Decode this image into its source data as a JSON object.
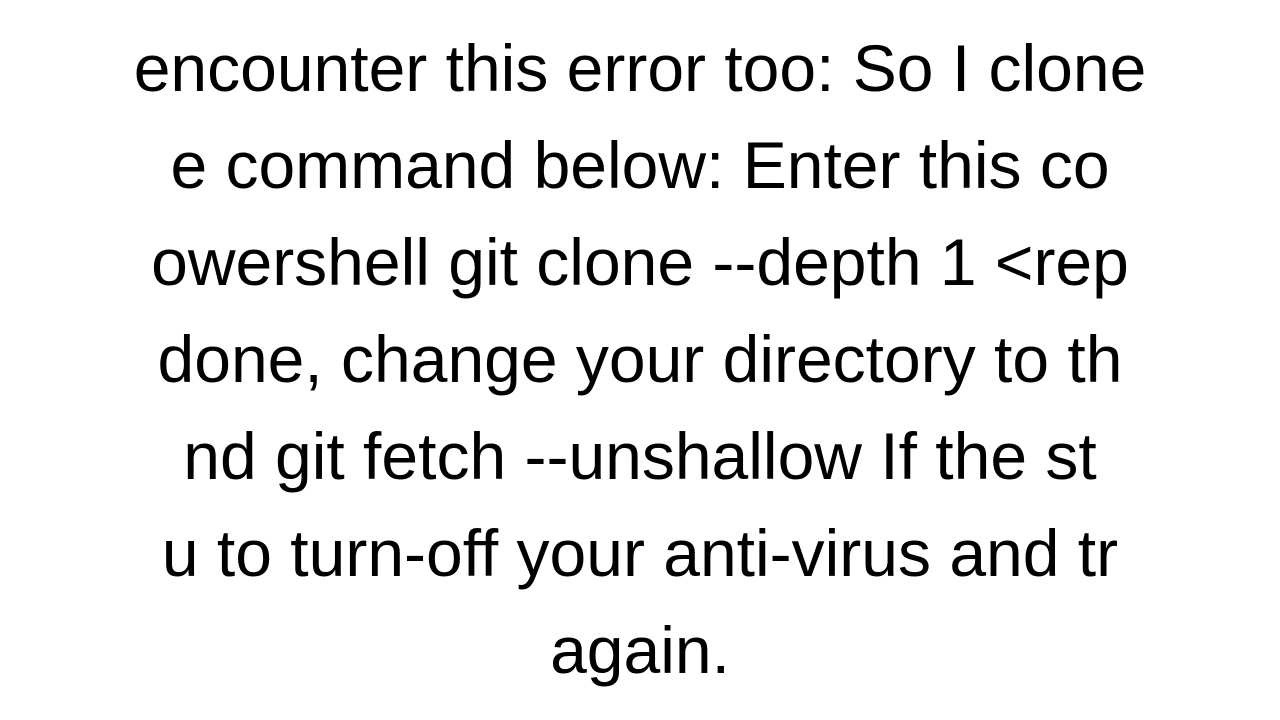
{
  "document": {
    "body_text": "encounter this error too: So I clone\ne command below:  Enter this co\nowershell git clone --depth 1 <rep\ndone, change your directory to th\nnd git fetch --unshallow  If the st\nu to turn-off your anti-virus and tr\nagain."
  }
}
